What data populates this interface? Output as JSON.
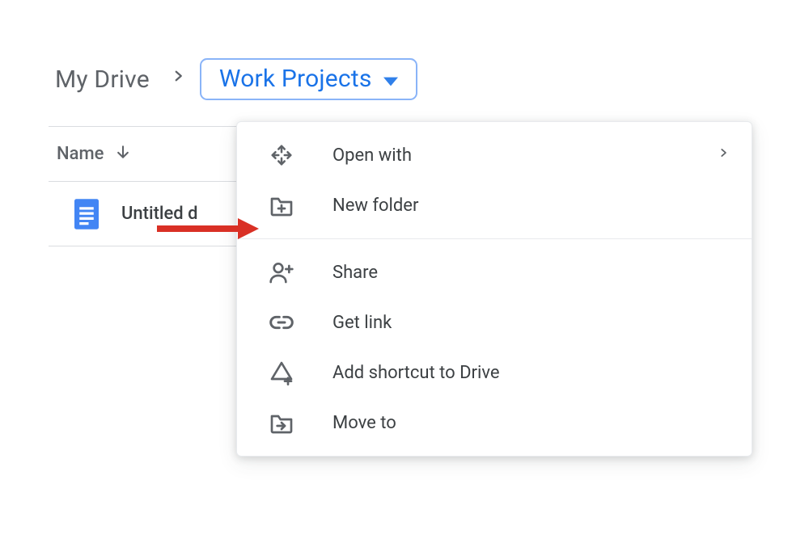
{
  "breadcrumb": {
    "root": "My Drive",
    "current": "Work Projects"
  },
  "table": {
    "name_header": "Name",
    "rows": [
      {
        "title": "Untitled d",
        "type": "document"
      }
    ]
  },
  "menu": {
    "items": [
      {
        "id": "open-with",
        "label": "Open with",
        "has_submenu": true
      },
      {
        "id": "new-folder",
        "label": "New folder",
        "has_submenu": false
      }
    ],
    "items2": [
      {
        "id": "share",
        "label": "Share",
        "has_submenu": false
      },
      {
        "id": "get-link",
        "label": "Get link",
        "has_submenu": false
      },
      {
        "id": "add-shortcut",
        "label": "Add shortcut to Drive",
        "has_submenu": false
      },
      {
        "id": "move-to",
        "label": "Move to",
        "has_submenu": false
      }
    ]
  },
  "colors": {
    "accent": "#1a73e8",
    "border": "#dadce0",
    "icon": "#5f6368",
    "arrow": "#d93025"
  }
}
